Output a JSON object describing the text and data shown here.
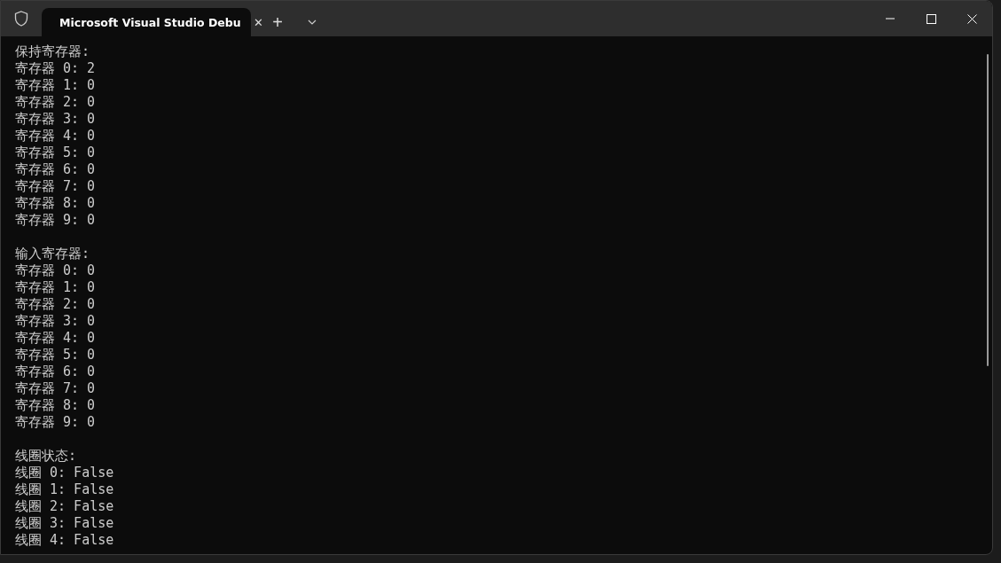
{
  "window": {
    "tab": {
      "title": "Microsoft Visual Studio Debu",
      "close": "✕"
    },
    "new_tab": "+"
  },
  "console": {
    "sections": [
      {
        "heading": "保持寄存器:",
        "lines": [
          "寄存器 0: 2",
          "寄存器 1: 0",
          "寄存器 2: 0",
          "寄存器 3: 0",
          "寄存器 4: 0",
          "寄存器 5: 0",
          "寄存器 6: 0",
          "寄存器 7: 0",
          "寄存器 8: 0",
          "寄存器 9: 0"
        ]
      },
      {
        "heading": "输入寄存器:",
        "lines": [
          "寄存器 0: 0",
          "寄存器 1: 0",
          "寄存器 2: 0",
          "寄存器 3: 0",
          "寄存器 4: 0",
          "寄存器 5: 0",
          "寄存器 6: 0",
          "寄存器 7: 0",
          "寄存器 8: 0",
          "寄存器 9: 0"
        ]
      },
      {
        "heading": "线圈状态:",
        "lines": [
          "线圈 0: False",
          "线圈 1: False",
          "线圈 2: False",
          "线圈 3: False",
          "线圈 4: False"
        ]
      }
    ]
  }
}
